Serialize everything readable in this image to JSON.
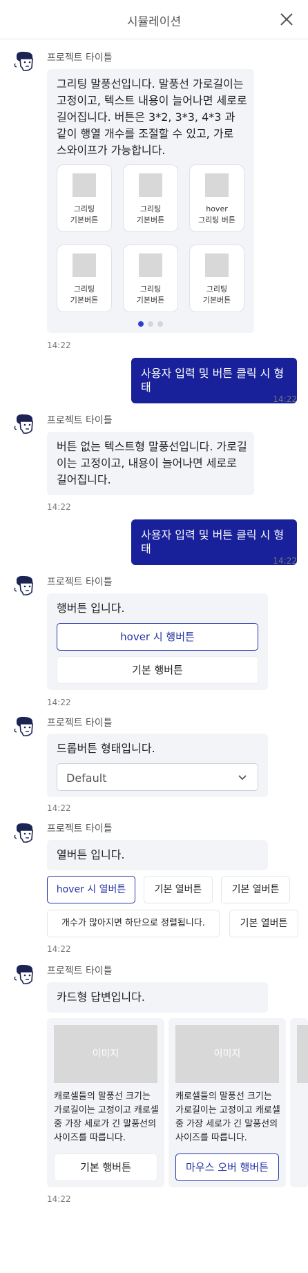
{
  "header": {
    "title": "시뮬레이션",
    "close_icon": "close-icon"
  },
  "bot": {
    "name": "프로젝트 타이틀",
    "avatar_icon": "bot-avatar-icon"
  },
  "colors": {
    "accent": "#18209a",
    "bubble_bg": "#f3f4f7",
    "placeholder": "#d8d8d8"
  },
  "messages": {
    "grid": {
      "text": "그리팅 말풍선입니다. 말풍선 가로길이는 고정이고, 텍스트 내용이 늘어나면 세로로 길어집니다. 버튼은 3*2, 3*3, 4*3 과 같이 행열 개수를 조절할 수 있고, 가로 스와이프가 가능합니다.",
      "buttons": [
        "그리팅\n기본버튼",
        "그리팅\n기본버튼",
        "hover\n그리팅 버튼",
        "그리팅\n기본버튼",
        "그리팅\n기본버튼",
        "그리팅\n기본버튼"
      ],
      "pagination": {
        "count": 3,
        "active": 1
      },
      "time": "14:22"
    },
    "user1": {
      "text": "사용자 입력 및 버튼 클릭 시 형태",
      "time": "14:22"
    },
    "text": {
      "text": "버튼 없는 텍스트형 말풍선입니다. 가로길이는 고정이고, 내용이 늘어나면 세로로 길어집니다.",
      "time": "14:22"
    },
    "user2": {
      "text": "사용자 입력 및 버튼 클릭 시 형태",
      "time": "14:22"
    },
    "row": {
      "text": "행버튼 입니다.",
      "buttons": [
        "hover 시 행버튼",
        "기본 행버튼"
      ],
      "time": "14:22"
    },
    "dropdown": {
      "text": "드롭버튼 형태입니다.",
      "value": "Default",
      "time": "14:22"
    },
    "column": {
      "text": "열버튼 입니다.",
      "buttons": [
        "hover 시 열버튼",
        "기본 열버튼",
        "기본 열버튼",
        "개수가 많아지면 하단으로 정렬됩니다.",
        "기본 열버튼"
      ],
      "time": "14:22"
    },
    "cards": {
      "text": "카드형 답변입니다.",
      "items": [
        {
          "image": "이미지",
          "desc": "캐로셀들의 말풍선 크기는 가로길이는 고정이고 캐로셀 중 가장 세로가 긴 말풍선의 사이즈를 따릅니다.",
          "button": "기본 행버튼"
        },
        {
          "image": "이미지",
          "desc": "캐로셀들의 말풍선 크기는 가로길이는 고정이고 캐로셀 중 가장 세로가 긴 말풍선의 사이즈를 따릅니다.",
          "button": "마우스 오버 행버튼"
        }
      ],
      "time": "14:22"
    }
  }
}
